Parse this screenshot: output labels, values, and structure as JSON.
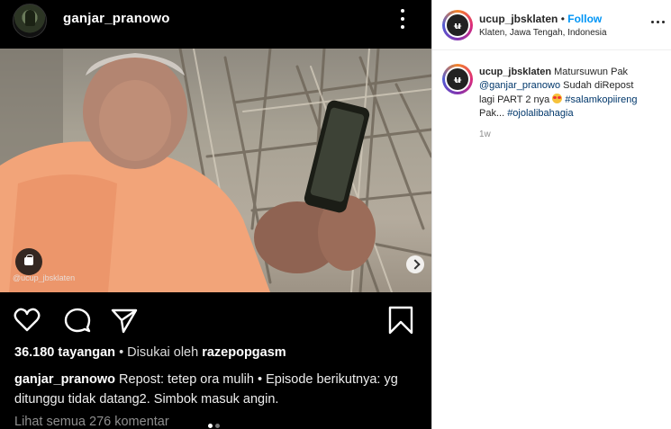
{
  "post": {
    "username": "ganjar_pranowo",
    "media": {
      "watermark": "@ucup_jbsklaten"
    },
    "stats": {
      "views": "36.180 tayangan",
      "separator_liked": "• Disukai oleh",
      "liked_by": "razepopgasm"
    },
    "caption": {
      "username": "ganjar_pranowo",
      "text": "Repost: tetep ora mulih • Episode berikutnya: yg ditunggu tidak datang2. Simbok masuk angin."
    },
    "view_comments": "Lihat semua 276 komentar",
    "carousel": {
      "total": 2,
      "active": 1
    }
  },
  "detail": {
    "header": {
      "username": "ucup_jbsklaten",
      "dot": " • ",
      "follow": "Follow",
      "location": "Klaten, Jawa Tengah, Indonesia"
    },
    "comment": {
      "username": "ucup_jbsklaten",
      "part1": " Matursuwun Pak ",
      "mention": "@ganjar_pranowo",
      "part2": " Sudah diRepost lagi PART 2 nya ",
      "tag1": "#salamkopiireng",
      "part3": " Pak... ",
      "tag2": "#ojolalibahagia",
      "time": "1w"
    },
    "avatar_logo": "ʉ"
  },
  "icons": {
    "more": "more-horizontal-icon",
    "like": "heart-icon",
    "comment": "comment-icon",
    "share": "send-icon",
    "save": "bookmark-icon",
    "next": "chevron-right-icon",
    "shop": "bag-icon"
  },
  "colors": {
    "follow": "#0095f6",
    "link": "#00376b",
    "dark_bg": "#000000"
  }
}
